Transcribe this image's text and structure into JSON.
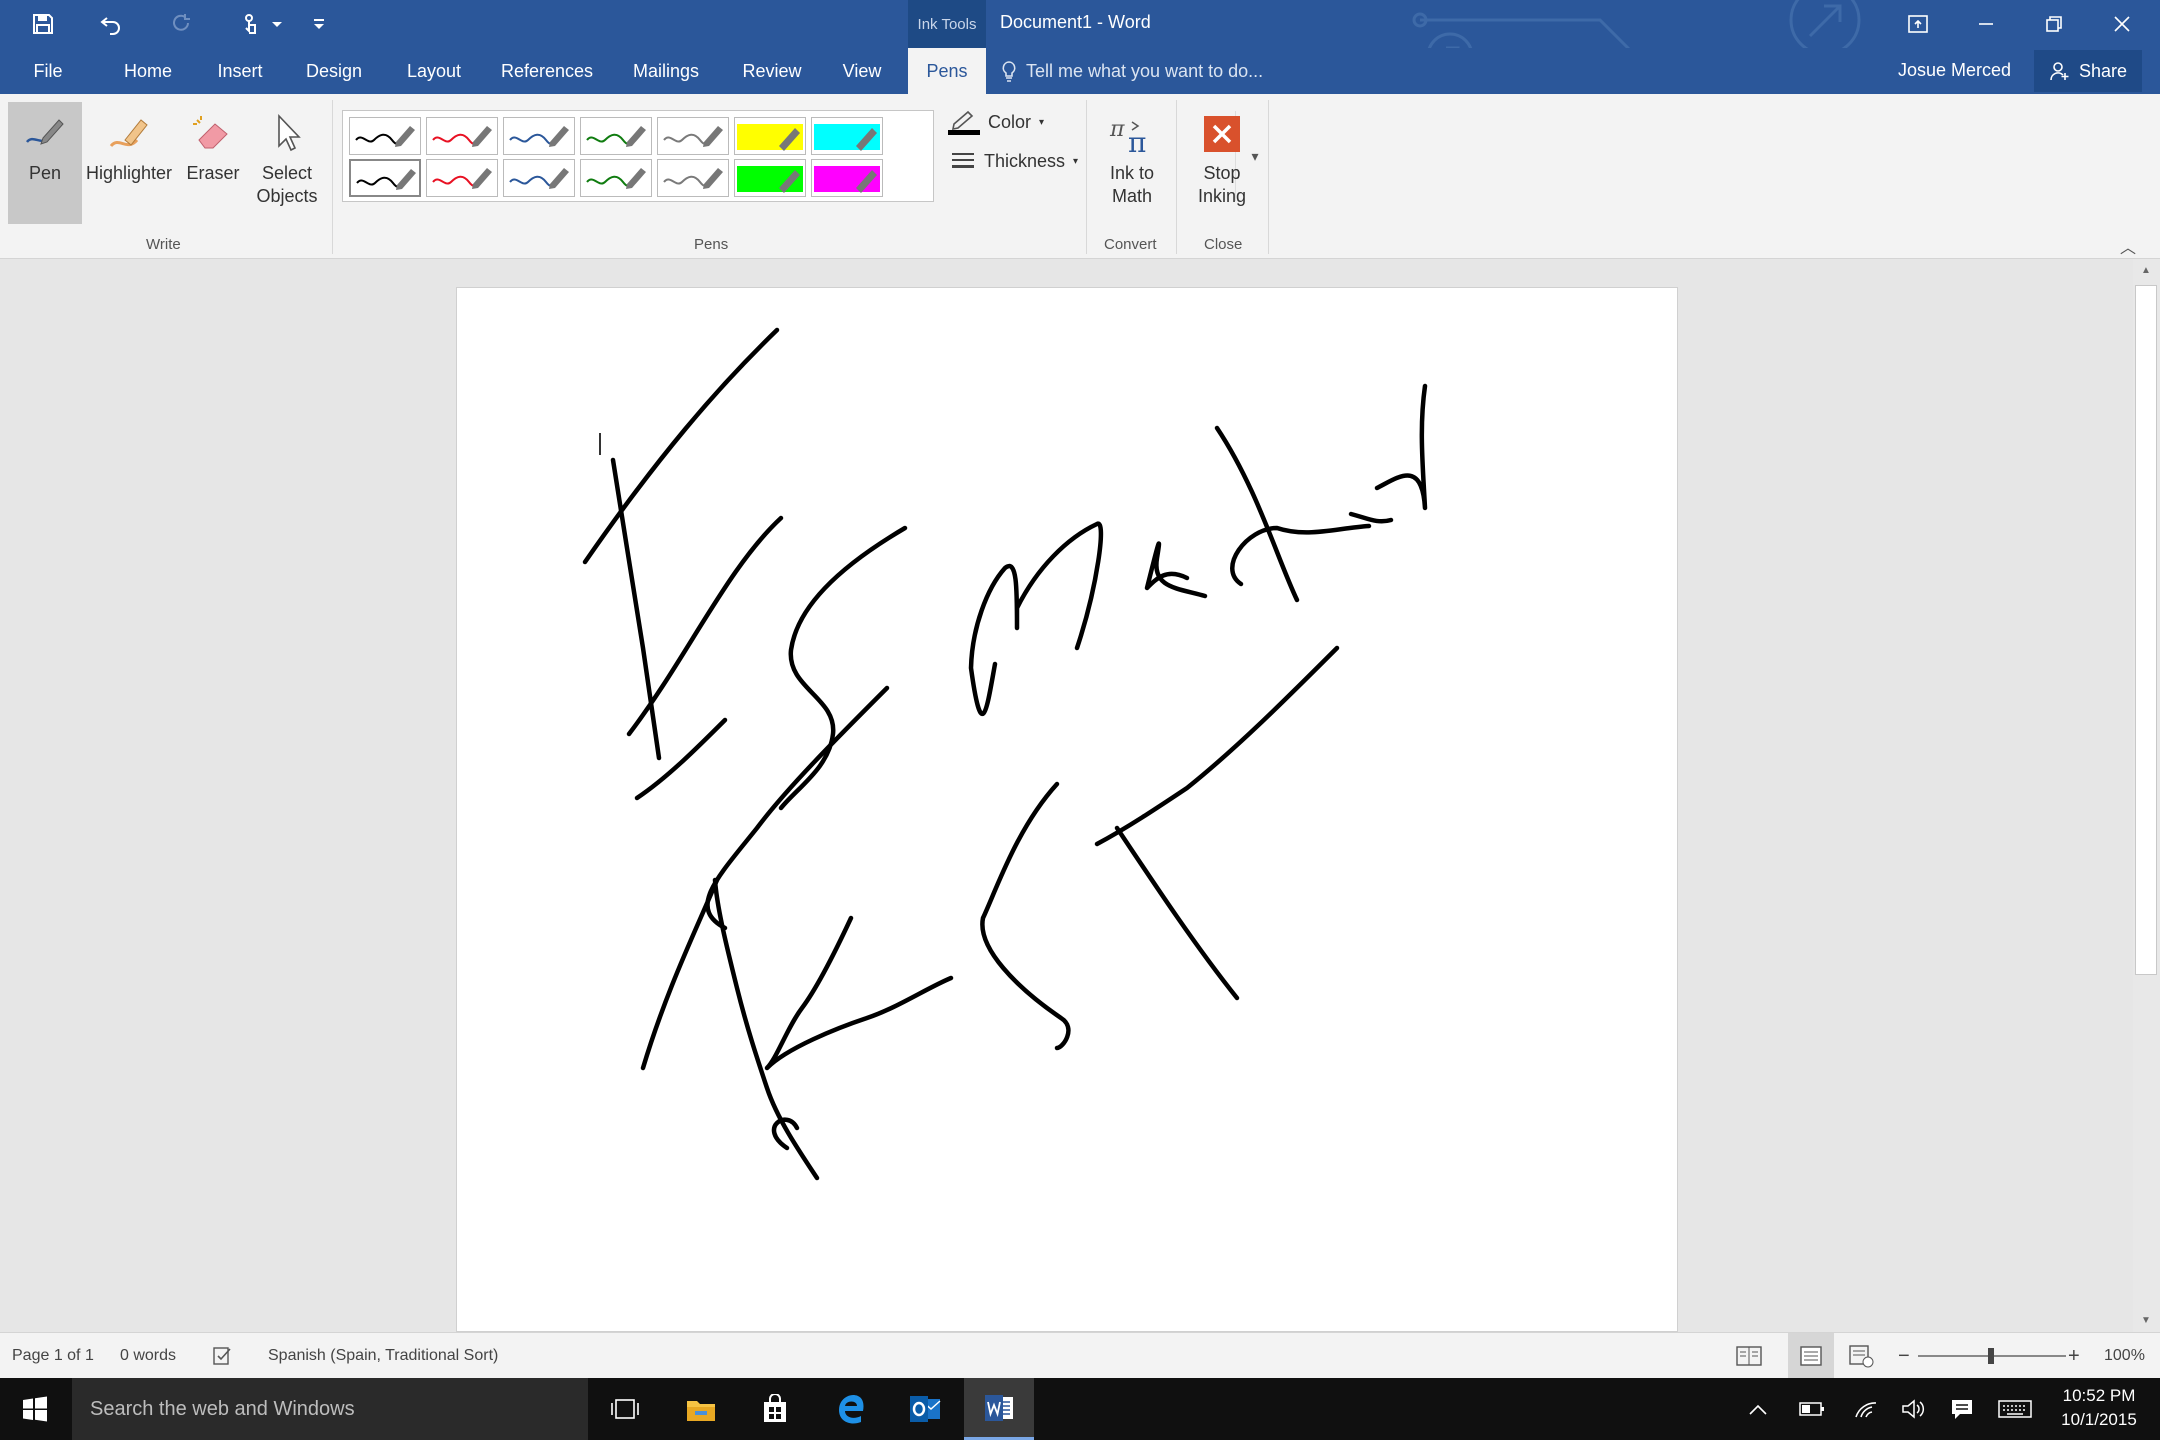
{
  "window": {
    "contextual_tab": "Ink Tools",
    "title": "Document1 - Word"
  },
  "tabs": [
    "File",
    "Home",
    "Insert",
    "Design",
    "Layout",
    "References",
    "Mailings",
    "Review",
    "View",
    "Pens"
  ],
  "active_tab": "Pens",
  "tell_me": "Tell me what you want to do...",
  "user": {
    "name": "Josue Merced",
    "share_label": "Share"
  },
  "ribbon": {
    "write": {
      "pen": "Pen",
      "highlighter": "Highlighter",
      "eraser": "Eraser",
      "select": "Select",
      "objects": "Objects",
      "group": "Write"
    },
    "pens": {
      "group": "Pens",
      "color_label": "Color",
      "thickness_label": "Thickness",
      "row1": [
        "#000000",
        "#e81123",
        "#2b579a",
        "#107c10",
        "#7a7a7a",
        "#ffff00",
        "#00ffff"
      ],
      "row2": [
        "#000000",
        "#e81123",
        "#2b579a",
        "#107c10",
        "#7a7a7a",
        "#00ff00",
        "#ff00ff"
      ]
    },
    "convert": {
      "ink_to": "Ink to",
      "math": "Math",
      "group": "Convert"
    },
    "close": {
      "stop": "Stop",
      "inking": "Inking",
      "group": "Close"
    }
  },
  "status": {
    "page": "Page 1 of 1",
    "words": "0 words",
    "language": "Spanish (Spain, Traditional Sort)",
    "zoom": "100%"
  },
  "taskbar": {
    "search": "Search the web and Windows",
    "time": "10:52 PM",
    "date": "10/1/2015"
  }
}
